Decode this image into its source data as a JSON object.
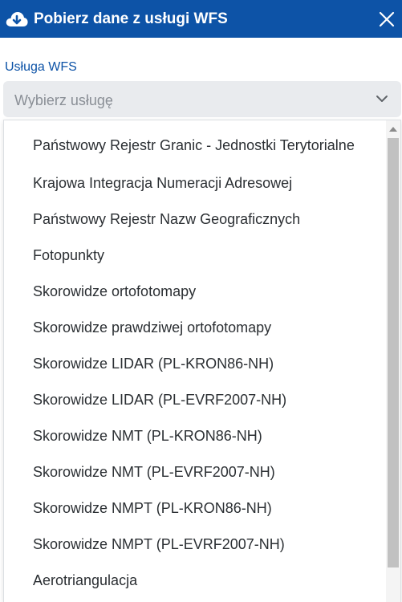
{
  "header": {
    "title": "Pobierz dane z usługi WFS",
    "icon": "cloud-download-icon",
    "close_icon": "close-icon"
  },
  "form": {
    "label": "Usługa WFS",
    "select": {
      "placeholder": "Wybierz usługę"
    }
  },
  "dropdown": {
    "options": [
      "Państwowy Rejestr Granic - Jednostki Terytorialne",
      "Krajowa Integracja Numeracji Adresowej",
      "Państwowy Rejestr Nazw Geograficznych",
      "Fotopunkty",
      "Skorowidze ortofotomapy",
      "Skorowidze prawdziwej ortofotomapy",
      "Skorowidze LIDAR (PL-KRON86-NH)",
      "Skorowidze LIDAR (PL-EVRF2007-NH)",
      "Skorowidze NMT (PL-KRON86-NH)",
      "Skorowidze NMT (PL-EVRF2007-NH)",
      "Skorowidze NMPT (PL-KRON86-NH)",
      "Skorowidze NMPT (PL-EVRF2007-NH)",
      "Aerotriangulacja"
    ]
  },
  "colors": {
    "header_bg": "#0d53a7",
    "label": "#0d53a7",
    "select_bg": "#e9ebee",
    "placeholder": "#8a8f96",
    "option_text": "#2b2f33"
  }
}
